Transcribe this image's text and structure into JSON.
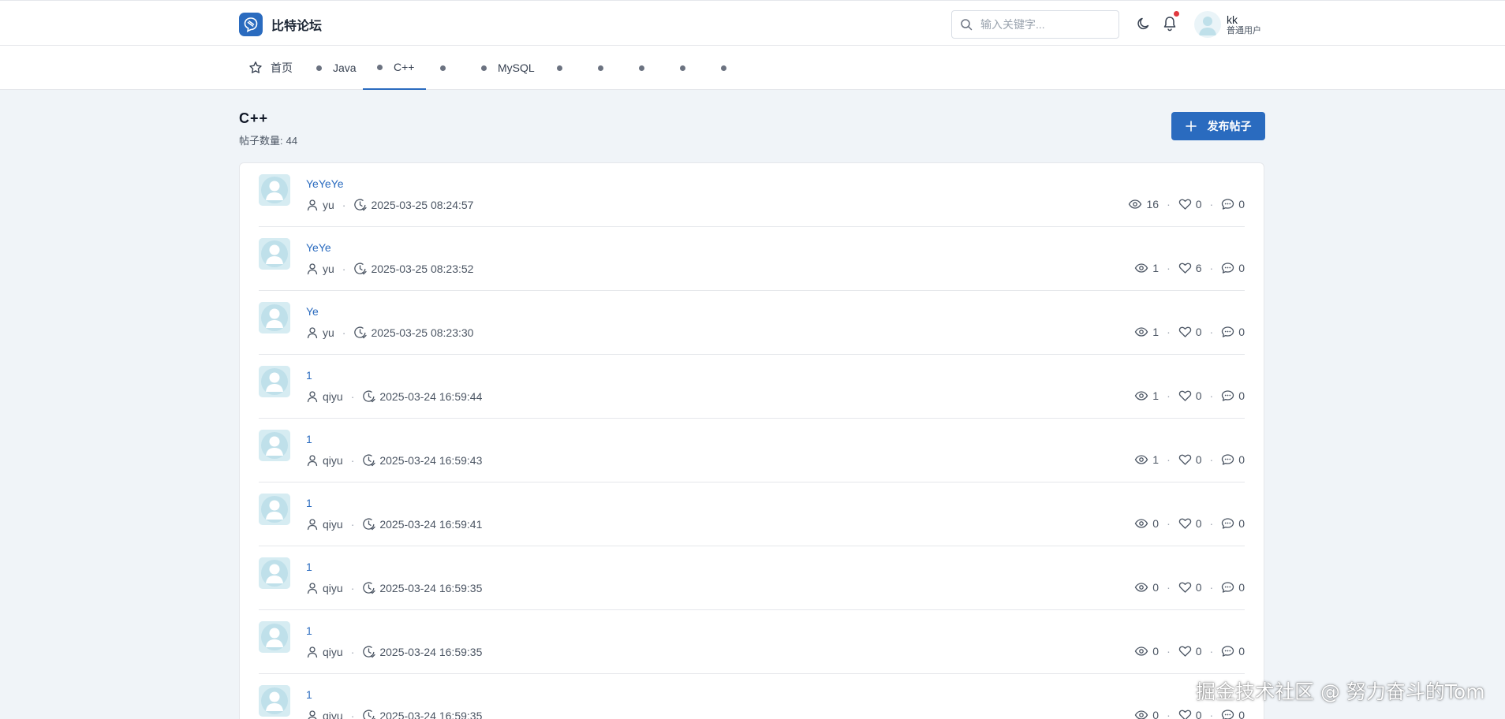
{
  "app": {
    "brand_name": "比特论坛",
    "search_placeholder": "输入关键字...",
    "user": {
      "name": "kk",
      "role": "普通用户"
    },
    "has_notification": true
  },
  "nav": {
    "home_label": "首页",
    "items": [
      "Java",
      "C++",
      "",
      "MySQL",
      "",
      "",
      "",
      "",
      ""
    ],
    "active": "C++"
  },
  "section": {
    "title": "C++",
    "count_label": "帖子数量:",
    "count": "44",
    "post_button_label": "发布帖子"
  },
  "posts": [
    {
      "title": "YeYeYe",
      "author": "yu",
      "time": "2025-03-25 08:24:57",
      "views": "16",
      "likes": "0",
      "comments": "0"
    },
    {
      "title": "YeYe",
      "author": "yu",
      "time": "2025-03-25 08:23:52",
      "views": "1",
      "likes": "6",
      "comments": "0"
    },
    {
      "title": "Ye",
      "author": "yu",
      "time": "2025-03-25 08:23:30",
      "views": "1",
      "likes": "0",
      "comments": "0"
    },
    {
      "title": "1",
      "author": "qiyu",
      "time": "2025-03-24 16:59:44",
      "views": "1",
      "likes": "0",
      "comments": "0"
    },
    {
      "title": "1",
      "author": "qiyu",
      "time": "2025-03-24 16:59:43",
      "views": "1",
      "likes": "0",
      "comments": "0"
    },
    {
      "title": "1",
      "author": "qiyu",
      "time": "2025-03-24 16:59:41",
      "views": "0",
      "likes": "0",
      "comments": "0"
    },
    {
      "title": "1",
      "author": "qiyu",
      "time": "2025-03-24 16:59:35",
      "views": "0",
      "likes": "0",
      "comments": "0"
    },
    {
      "title": "1",
      "author": "qiyu",
      "time": "2025-03-24 16:59:35",
      "views": "0",
      "likes": "0",
      "comments": "0"
    },
    {
      "title": "1",
      "author": "qiyu",
      "time": "2025-03-24 16:59:35",
      "views": "0",
      "likes": "0",
      "comments": "0"
    }
  ],
  "watermark": "掘金技术社区 @ 努力奋斗的Tom",
  "colors": {
    "accent": "#2a6bbf",
    "page_bg": "#f0f4f8",
    "notification": "#e0383e"
  }
}
